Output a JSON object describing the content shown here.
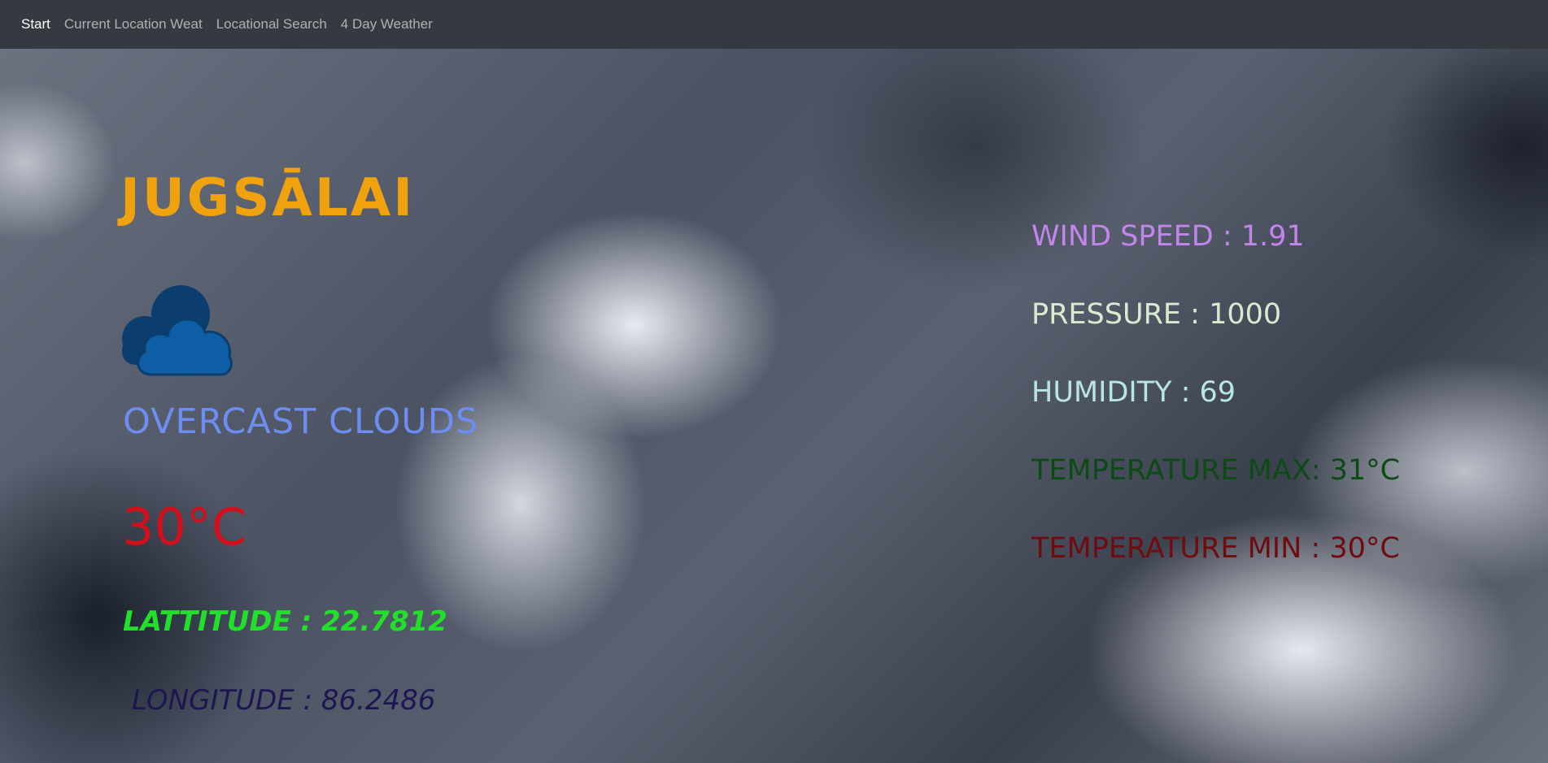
{
  "nav": {
    "items": [
      {
        "label": "Start",
        "active": true
      },
      {
        "label": "Current Location Weat",
        "active": false
      },
      {
        "label": "Locational Search",
        "active": false
      },
      {
        "label": "4 Day Weather",
        "active": false
      }
    ]
  },
  "weather": {
    "city": "JUGSĀLAI",
    "icon": "overcast-clouds-icon",
    "description": "OVERCAST CLOUDS",
    "temperature": "30°C",
    "latitude": "LATTITUDE : 22.7812",
    "longitude": "LONGITUDE : 86.2486"
  },
  "stats": {
    "wind_speed": "WIND SPEED : 1.91",
    "pressure": "PRESSURE : 1000",
    "humidity": "HUMIDITY : 69",
    "temp_max": "TEMPERATURE MAX: 31°C",
    "temp_min": "TEMPERATURE MIN : 30°C"
  },
  "colors": {
    "navbar": "#343a40",
    "city": "#f0a10e",
    "description": "#6d8ef0",
    "temperature": "#d0101b",
    "latitude": "#22e02a",
    "longitude": "#1d1650",
    "wind": "#c285ec",
    "pressure": "#d8ebcf",
    "humidity": "#b8e6e4",
    "temp_max": "#0d4a16",
    "temp_min": "#700c10",
    "cloud_back": "#0b3d6e",
    "cloud_front": "#0e5ea6"
  }
}
